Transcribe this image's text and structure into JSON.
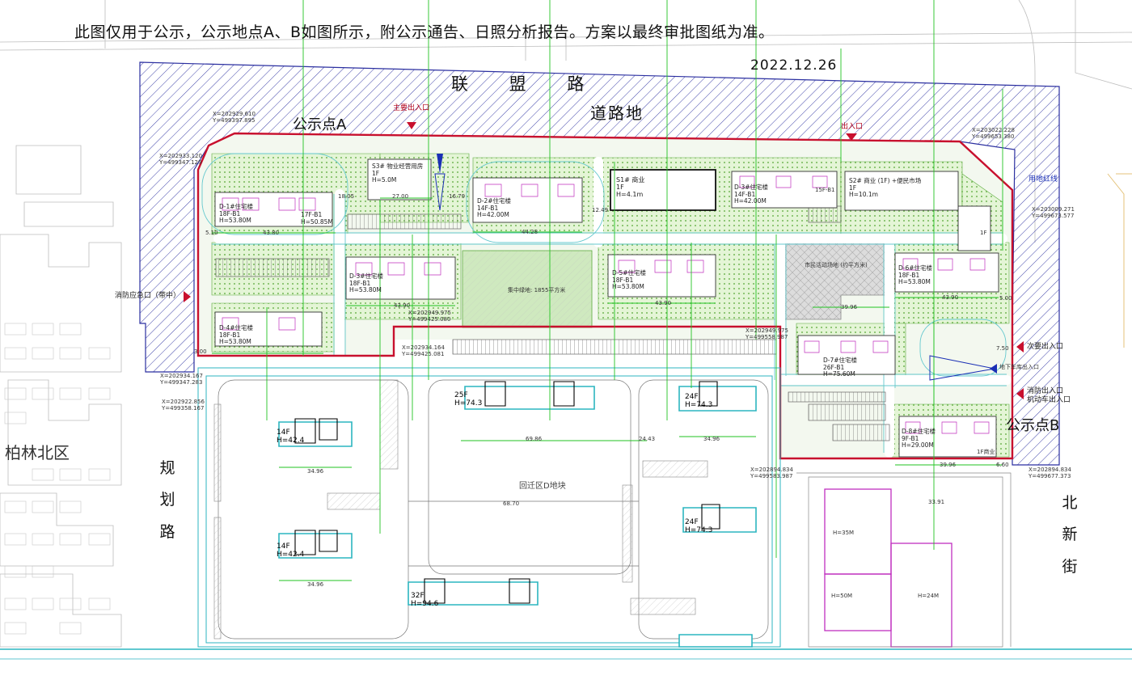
{
  "header": {
    "notice": "此图仅用于公示，公示地点A、B如图所示，附公示通告、日照分析报告。方案以最终审批图纸为准。",
    "date": "2022.12.26"
  },
  "roads": {
    "north_name": "联 盟 路",
    "north_sub": "道路地",
    "west_name": [
      "规",
      "划",
      "路"
    ],
    "east_name": [
      "北",
      "新",
      "街"
    ],
    "neighborhood": "柏林北区",
    "center_block": "回迁区D地块"
  },
  "points": {
    "a": "公示点A",
    "b": "公示点B"
  },
  "entrances": {
    "main": "主要出入口",
    "exit": "出入口",
    "emergency_west": "消防应急口（带中）",
    "secondary_east": "次要出入口",
    "underground": "地下车库出入口",
    "fire_vehicle": [
      "消防出入口",
      "机动车出入口"
    ],
    "boundary": "用地红线"
  },
  "buildings": [
    {
      "id": "b1",
      "lines": [
        "D-1#住宅楼",
        "18F-B1",
        "H=53.80M"
      ]
    },
    {
      "id": "b2",
      "lines": [
        "17F-B1",
        "H=50.85M"
      ]
    },
    {
      "id": "b3",
      "lines": [
        "D-4#住宅楼",
        "18F-B1",
        "H=53.80M"
      ]
    },
    {
      "id": "b4",
      "lines": [
        "D-3#住宅楼",
        "18F-B1",
        "H=53.80M"
      ]
    },
    {
      "id": "b5",
      "lines": [
        "D-2#住宅楼",
        "14F-B1",
        "H=42.00M"
      ]
    },
    {
      "id": "b6",
      "lines": [
        "D-5#住宅楼",
        "18F-B1",
        "H=53.80M"
      ]
    },
    {
      "id": "b7",
      "lines": [
        "D-3#住宅楼",
        "14F-B1",
        "H=42.00M"
      ]
    },
    {
      "id": "b8",
      "lines": [
        "D-6#住宅楼",
        "18F-B1",
        "H=53.80M"
      ]
    },
    {
      "id": "b9",
      "lines": [
        "D-7#住宅楼",
        "26F-B1",
        "H=75.60M"
      ]
    },
    {
      "id": "b10",
      "lines": [
        "D-8#住宅楼",
        "9F-B1",
        "H=29.00M"
      ]
    }
  ],
  "facilities": {
    "s3": [
      "S3# 物业经营用房",
      "1F",
      "H=5.0M"
    ],
    "s1": [
      "S1# 商业",
      "1F",
      "H=4.1m"
    ],
    "s2": [
      "S2# 商业 (1F) +便民市场",
      "1F",
      "H=10.1m"
    ],
    "s2_note": "15F-B1",
    "green": "集中绿地: 1855平方米",
    "plaza": "市民活动场地 (约平方米)",
    "commercial": "1F商业",
    "shop": "1F"
  },
  "south_towers": [
    {
      "id": "t1",
      "floors": "25F",
      "height": "H=74.3"
    },
    {
      "id": "t2",
      "floors": "24F",
      "height": "H=74.3"
    },
    {
      "id": "t3",
      "floors": "14F",
      "height": "H=42.4"
    },
    {
      "id": "t4",
      "floors": "24F",
      "height": "H=74.3"
    },
    {
      "id": "t5",
      "floors": "14F",
      "height": "H=42.4"
    },
    {
      "id": "t6",
      "floors": "32F",
      "height": "H=94.6"
    }
  ],
  "east_blocks": {
    "a": "H=35M",
    "b": "H=50M",
    "c": "H=24M"
  },
  "dims": {
    "d1": "43.80",
    "d2": "27.00",
    "d3": "44.28",
    "d4": "43.90",
    "d5": "43.90",
    "d6": "39.96",
    "d7": "69.86",
    "d8": "24.43",
    "d9": "34.96",
    "d10": "34.96",
    "d11": "34.96",
    "d12": "43.90",
    "d13": "39.96",
    "d14": "6.60",
    "d15": "18.05",
    "d16": "16.79",
    "d17": "12.49",
    "d18": "5.10",
    "d19": "3.00",
    "d20": "7.50",
    "d21": "5.00",
    "d22": "68.70",
    "d23": "33.91"
  },
  "coords": {
    "c1": [
      "X=202929.610",
      "Y=499397.895"
    ],
    "c2": [
      "X=202933.120",
      "Y=499347.129"
    ],
    "c3": [
      "X=202934.167",
      "Y=499347.283"
    ],
    "c4": [
      "X=202922.856",
      "Y=499358.167"
    ],
    "c5": [
      "X=203022.228",
      "Y=499653.380"
    ],
    "c6": [
      "X=203009.271",
      "Y=499673.577"
    ],
    "c7": [
      "X=202949.975",
      "Y=499425.080"
    ],
    "c8": [
      "X=202934.164",
      "Y=499425.081"
    ],
    "c9": [
      "X=202949.975",
      "Y=499558.987"
    ],
    "c10": [
      "X=202894.834",
      "Y=499583.987"
    ],
    "c11": [
      "X=202894.834",
      "Y=499677.373"
    ]
  },
  "colors": {
    "boundary": "#c8102e",
    "hatch": "#2b2fa0",
    "green": "#7cc35a",
    "cyan": "#2cb5c0",
    "magenta": "#c02fbf",
    "dimension": "#22c322"
  }
}
